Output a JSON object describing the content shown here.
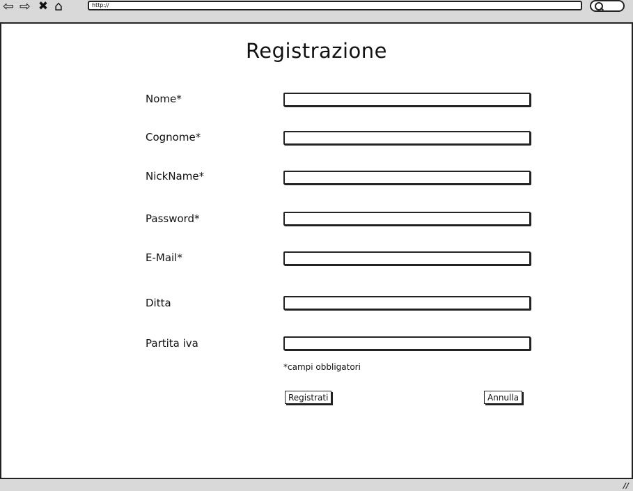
{
  "browser": {
    "url": "http://",
    "icons": [
      "back-arrow-icon",
      "forward-arrow-icon",
      "stop-icon",
      "home-icon",
      "search-icon"
    ]
  },
  "form": {
    "title": "Registrazione",
    "fields": [
      {
        "label": "Nome*",
        "value": ""
      },
      {
        "label": "Cognome*",
        "value": ""
      },
      {
        "label": "NickName*",
        "value": ""
      },
      {
        "label": "Password*",
        "value": ""
      },
      {
        "label": "E-Mail*",
        "value": ""
      },
      {
        "label": "Ditta",
        "value": ""
      },
      {
        "label": "Partita iva",
        "value": ""
      }
    ],
    "required_note": "*campi obbligatori",
    "submit_label": "Registrati",
    "cancel_label": "Annulla"
  }
}
